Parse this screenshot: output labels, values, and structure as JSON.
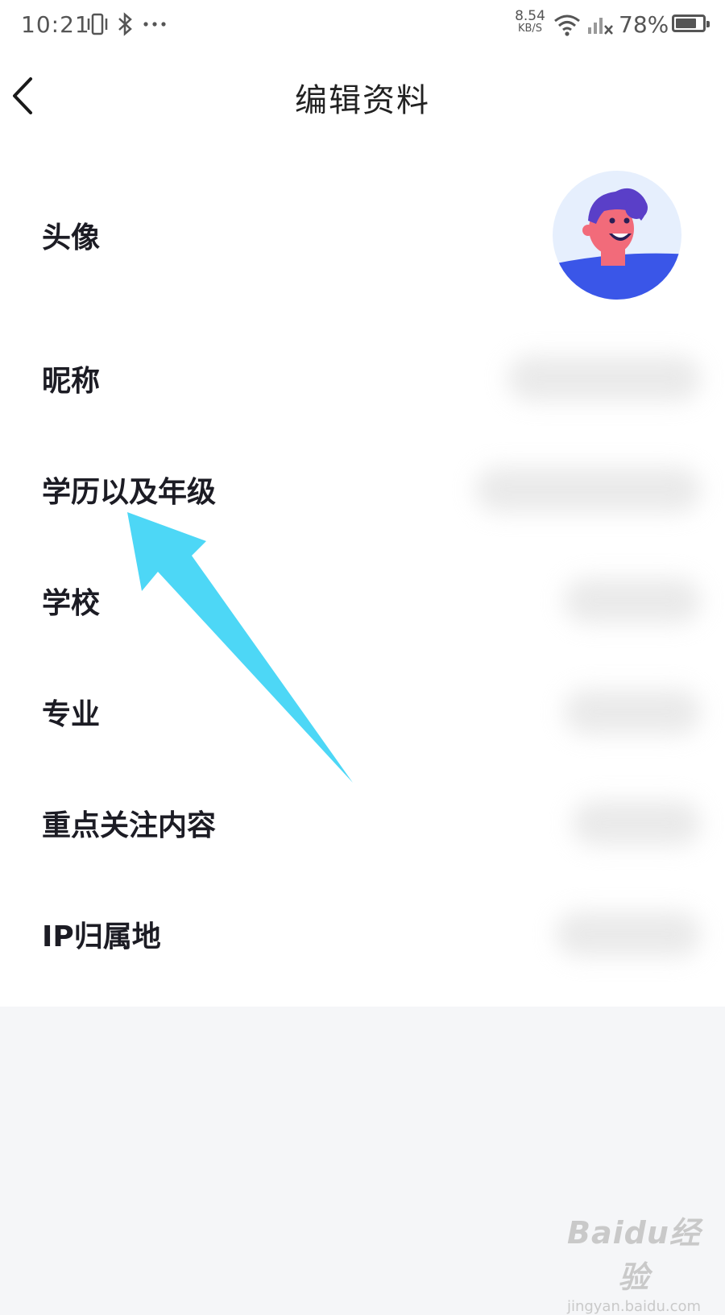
{
  "status_bar": {
    "time": "10:21",
    "net_speed": "8.54",
    "net_speed_unit": "KB/S",
    "battery_percent": "78%",
    "battery_level": 0.78,
    "icons": [
      "vibrate-icon",
      "bluetooth-icon",
      "more-dots-icon",
      "wifi-icon",
      "signal-icon",
      "battery-icon"
    ]
  },
  "header": {
    "title": "编辑资料",
    "back_icon": "chevron-left-icon"
  },
  "profile": {
    "rows": [
      {
        "label": "头像"
      },
      {
        "label": "昵称"
      },
      {
        "label": "学历以及年级"
      },
      {
        "label": "学校"
      },
      {
        "label": "专业"
      },
      {
        "label": "重点关注内容"
      },
      {
        "label": "IP归属地"
      }
    ]
  },
  "annotation": {
    "arrow_color": "#4dd7f6",
    "icon": "arrow-annotation-icon"
  },
  "watermark": {
    "logo": "Baidu经验",
    "url": "jingyan.baidu.com"
  },
  "colors": {
    "background": "#f5f6f8",
    "card": "#ffffff",
    "text": "#1c1c24",
    "avatar_bg": "#e6effd",
    "avatar_shirt": "#3a56e8",
    "avatar_hair": "#5a3fc8",
    "avatar_skin": "#f26b7a"
  }
}
